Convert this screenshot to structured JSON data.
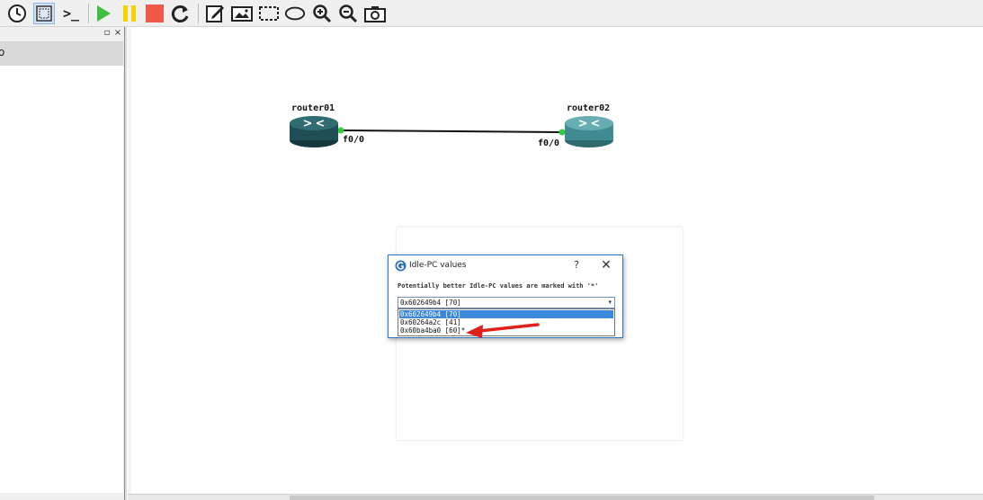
{
  "toolbar": {
    "buttons": [
      {
        "name": "snapshot-icon"
      },
      {
        "name": "show-interface-labels-icon"
      },
      {
        "name": "console-icon",
        "label": ">_"
      },
      {
        "name": "start-all-icon"
      },
      {
        "name": "suspend-all-icon"
      },
      {
        "name": "stop-all-icon"
      },
      {
        "name": "reload-all-icon"
      },
      {
        "name": "add-note-icon"
      },
      {
        "name": "insert-picture-icon"
      },
      {
        "name": "draw-rectangle-icon"
      },
      {
        "name": "draw-ellipse-icon"
      },
      {
        "name": "zoom-in-icon"
      },
      {
        "name": "zoom-out-icon"
      },
      {
        "name": "screenshot-icon"
      }
    ],
    "console_label": ">_"
  },
  "dock": {
    "float_glyph": "▫",
    "close_glyph": "×",
    "header_text": "o"
  },
  "topology": {
    "routers": [
      {
        "name": "router01",
        "interface": "f0/0"
      },
      {
        "name": "router02",
        "interface": "f0/0"
      }
    ]
  },
  "dialog": {
    "title": "Idle-PC values",
    "help": "?",
    "close": "✕",
    "message": "Potentially better Idle-PC values are marked with '*'",
    "selected": "0x602649b4 [70]",
    "arrow": "▾",
    "options": [
      "0x602649b4 [70]",
      "0x60264a2c [41]",
      "0x60ba4ba0 [60]*"
    ]
  },
  "colors": {
    "router01": "#1f4f55",
    "router02": "#3f8b91",
    "link": "#111111",
    "link_dot": "#2ecc40",
    "annotation_arrow": "#e0201b"
  }
}
